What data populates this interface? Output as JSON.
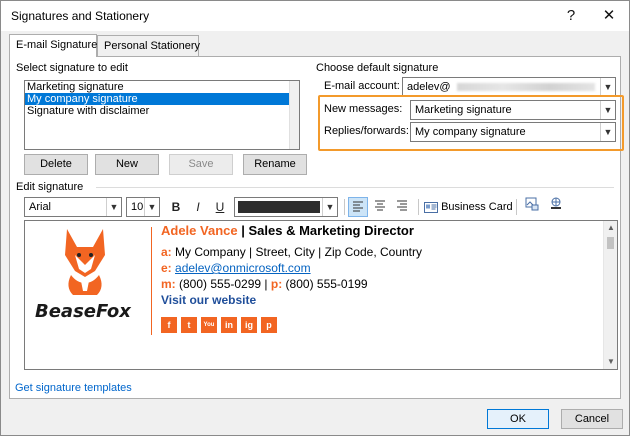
{
  "window": {
    "title": "Signatures and Stationery",
    "help": "?",
    "close": "✕"
  },
  "tabs": [
    {
      "label": "E-mail Signature",
      "active": true
    },
    {
      "label": "Personal Stationery",
      "active": false
    }
  ],
  "select_section": {
    "label": "Select signature to edit",
    "items": [
      "Marketing signature",
      "My company signature",
      "Signature with disclaimer"
    ],
    "selected_index": 1
  },
  "buttons": {
    "delete": "Delete",
    "new": "New",
    "save": "Save",
    "rename": "Rename"
  },
  "default_section": {
    "label": "Choose default signature",
    "email_account_label": "E-mail account:",
    "email_account_value": "adelev@",
    "new_messages_label": "New messages:",
    "new_messages_value": "Marketing signature",
    "replies_label": "Replies/forwards:",
    "replies_value": "My company signature"
  },
  "edit_section": {
    "label": "Edit signature",
    "font_name": "Arial",
    "font_size": "10",
    "bold": "B",
    "italic": "I",
    "underline": "U",
    "business_card": "Business Card"
  },
  "signature": {
    "logo_text": "BeaseFox",
    "name": "Adele Vance",
    "separator": " | ",
    "job_title": "Sales & Marketing Director",
    "address_prefix": "a:",
    "address": "My Company | Street, City | Zip Code, Country",
    "email_prefix": "e:",
    "email": "adelev@onmicrosoft.com",
    "phone_prefix": "m:",
    "phone": "(800) 555-0299",
    "phone_sep": " | ",
    "fax_prefix": "p:",
    "fax": "(800) 555-0199",
    "website": "Visit our website",
    "social": [
      "f",
      "t",
      "You",
      "in",
      "ig",
      "p"
    ]
  },
  "templates_link": "Get signature templates",
  "footer": {
    "ok": "OK",
    "cancel": "Cancel"
  },
  "colors": {
    "accent": "#f26522",
    "highlight": "#f39a2b",
    "selection": "#0078d7"
  }
}
